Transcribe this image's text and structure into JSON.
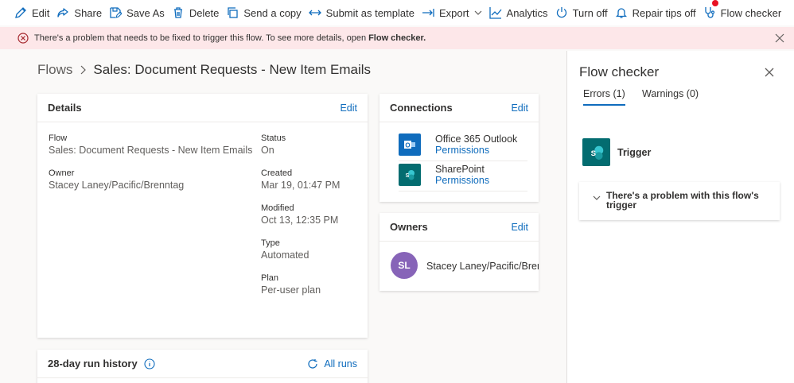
{
  "toolbar": {
    "items": [
      {
        "label": "Edit",
        "icon": "pencil-icon"
      },
      {
        "label": "Share",
        "icon": "share-icon"
      },
      {
        "label": "Save As",
        "icon": "save-as-icon"
      },
      {
        "label": "Delete",
        "icon": "trash-icon"
      },
      {
        "label": "Send a copy",
        "icon": "copy-icon"
      },
      {
        "label": "Submit as template",
        "icon": "arrow-left-right-icon"
      },
      {
        "label": "Export",
        "icon": "export-icon"
      },
      {
        "label": "Analytics",
        "icon": "analytics-icon"
      },
      {
        "label": "Turn off",
        "icon": "power-icon"
      },
      {
        "label": "Repair tips off",
        "icon": "bell-icon"
      },
      {
        "label": "Flow checker",
        "icon": "stethoscope-icon"
      }
    ]
  },
  "banner": {
    "message": "There's a problem that needs to be fixed to trigger this flow. To see more details, open",
    "link": "Flow checker."
  },
  "breadcrumb": {
    "root": "Flows",
    "current": "Sales: Document Requests - New Item Emails"
  },
  "details": {
    "title": "Details",
    "edit": "Edit",
    "flow_label": "Flow",
    "flow_value": "Sales: Document Requests - New Item Emails",
    "owner_label": "Owner",
    "owner_value": "Stacey Laney/Pacific/Brenntag",
    "status_label": "Status",
    "status_value": "On",
    "created_label": "Created",
    "created_value": "Mar 19, 01:47 PM",
    "modified_label": "Modified",
    "modified_value": "Oct 13, 12:35 PM",
    "type_label": "Type",
    "type_value": "Automated",
    "plan_label": "Plan",
    "plan_value": "Per-user plan"
  },
  "connections": {
    "title": "Connections",
    "edit": "Edit",
    "items": [
      {
        "name": "Office 365 Outlook",
        "link": "Permissions",
        "color": "#0f6cbd"
      },
      {
        "name": "SharePoint",
        "link": "Permissions",
        "color": "#036c70"
      }
    ]
  },
  "owners": {
    "title": "Owners",
    "edit": "Edit",
    "initials": "SL",
    "name": "Stacey Laney/Pacific/Brenntag"
  },
  "run_history": {
    "title": "28-day run history",
    "all_runs": "All runs"
  },
  "flow_checker": {
    "title": "Flow checker",
    "tabs": [
      "Errors (1)",
      "Warnings (0)"
    ],
    "trigger_label": "Trigger",
    "problem": "There's a problem with this flow's trigger"
  },
  "colors": {
    "accent": "#0f6cbd",
    "error": "#a4262c",
    "banner_bg": "#fde7e9",
    "avatar": "#8764b8",
    "sharepoint": "#036c70"
  }
}
